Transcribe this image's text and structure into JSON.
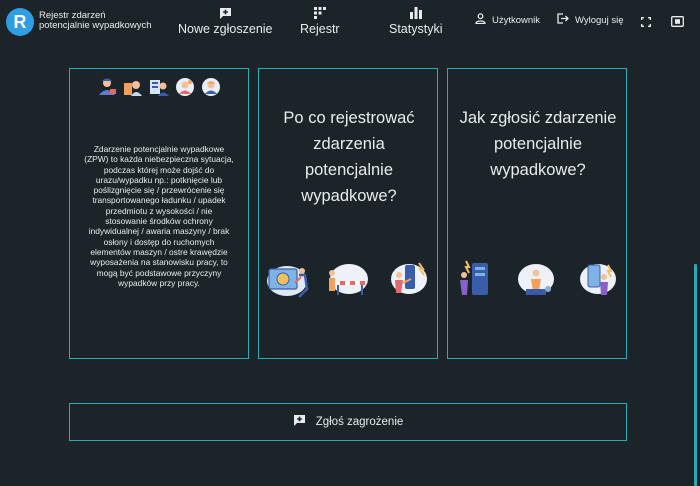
{
  "header": {
    "logo_letter": "R",
    "app_title_line1": "Rejestr zdarzeń",
    "app_title_line2": "potencjalnie wypadkowych",
    "nav": [
      {
        "label": "Nowe zgłoszenie",
        "icon": "add-comment-icon"
      },
      {
        "label": "Rejestr",
        "icon": "dots-grid-icon"
      },
      {
        "label": "Statystyki",
        "icon": "bar-chart-icon"
      }
    ],
    "user_label": "Użytkownik",
    "logout_label": "Wyloguj się"
  },
  "cards": {
    "description": "Zdarzenie potencjalnie wypadkowe (ZPW) to każda niebezpieczna sytuacja, podczas której może dojść do urazu/wypadku np.: potknięcie lub poślizgnięcie się / przewrócenie się transportowanego ładunku / upadek przedmiotu z wysokości / nie stosowanie środków ochrony indywidualnej / awaria maszyny / brak osłony i dostęp do ruchomych elementów maszyn / ostre krawędzie wyposażenia na stanowisku pracy, to mogą być podstawowe przyczyny wypadków przy pracy.",
    "why_title": "Po co rejestrować zdarzenia potencjalnie wypadkowe?",
    "how_title": "Jak zgłosić zdarzenie potencjalnie wypadkowe?"
  },
  "report_button": {
    "label": "Zgłoś zagrożenie",
    "icon": "add-comment-icon"
  },
  "colors": {
    "background": "#1b2429",
    "accent": "#2aa9b7",
    "logo": "#2f9ee3"
  }
}
